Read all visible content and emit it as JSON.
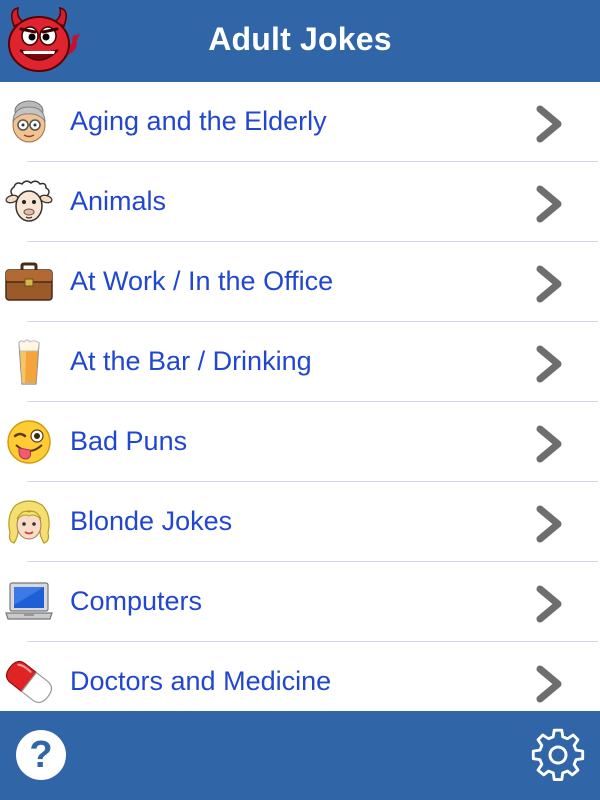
{
  "app": {
    "title": "Adult Jokes",
    "logo_icon": "devil-face-icon",
    "header_color": "#3065a7",
    "label_color": "#2146d1"
  },
  "categories": [
    {
      "label": "Aging and the Elderly",
      "icon": "elderly-woman-icon"
    },
    {
      "label": "Animals",
      "icon": "sheep-icon"
    },
    {
      "label": "At Work / In the Office",
      "icon": "briefcase-icon"
    },
    {
      "label": "At the Bar / Drinking",
      "icon": "beer-glass-icon"
    },
    {
      "label": "Bad Puns",
      "icon": "winking-tongue-face-icon"
    },
    {
      "label": "Blonde Jokes",
      "icon": "blonde-woman-icon"
    },
    {
      "label": "Computers",
      "icon": "laptop-icon"
    },
    {
      "label": "Doctors and Medicine",
      "icon": "pill-icon"
    }
  ],
  "footer": {
    "help_label": "?",
    "help_icon": "help-icon",
    "settings_icon": "gear-icon"
  }
}
